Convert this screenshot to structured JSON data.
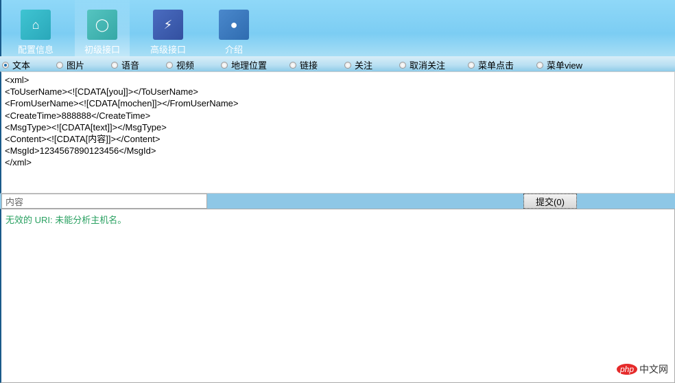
{
  "nav": [
    {
      "label": "配置信息",
      "icon": "home-icon",
      "color": "#2fb8c8"
    },
    {
      "label": "初级接口",
      "icon": "refresh-icon",
      "color": "#3db3b0",
      "selected": true
    },
    {
      "label": "高级接口",
      "icon": "chart-icon",
      "color": "#3a5db0"
    },
    {
      "label": "介绍",
      "icon": "globe-icon",
      "color": "#3a78c0"
    }
  ],
  "radios": [
    "文本",
    "图片",
    "语音",
    "视频",
    "地理位置",
    "链接",
    "关注",
    "取消关注",
    "菜单点击",
    "菜单view"
  ],
  "xml": "<xml>\n<ToUserName><![CDATA[you]]></ToUserName>\n<FromUserName><![CDATA[mochen]]></FromUserName>\n<CreateTime>888888</CreateTime>\n<MsgType><![CDATA[text]]></MsgType>\n<Content><![CDATA[内容]]></Content>\n<MsgId>1234567890123456</MsgId>\n</xml>",
  "content_value": "内容",
  "submit_label": "提交(0)",
  "output": "无效的 URI: 未能分析主机名。",
  "watermark": {
    "badge": "php",
    "text": "中文网"
  }
}
